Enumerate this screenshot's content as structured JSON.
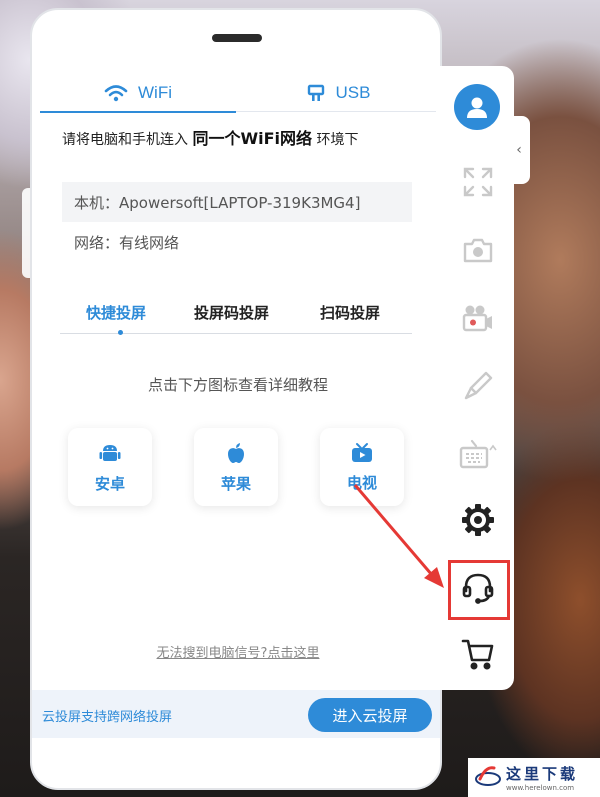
{
  "connection_tabs": {
    "wifi": "WiFi",
    "usb": "USB"
  },
  "instruction": {
    "prefix": "请将电脑和手机连入 ",
    "emphasis": "同一个WiFi网络",
    "suffix": " 环境下"
  },
  "device": {
    "label": "本机：Apowersoft[LAPTOP-319K3MG4]"
  },
  "network": {
    "label": "网络：有线网络"
  },
  "modes": [
    "快捷投屏",
    "投屏码投屏",
    "扫码投屏"
  ],
  "tutorial_hint": "点击下方图标查看详细教程",
  "os_cards": [
    "安卓",
    "苹果",
    "电视"
  ],
  "help_link": "无法搜到电脑信号?点击这里",
  "cloud": {
    "description": "云投屏支持跨网络投屏",
    "button": "进入云投屏"
  },
  "toolbar_icons": [
    "user-icon",
    "fullscreen-icon",
    "screenshot-camera-icon",
    "record-video-icon",
    "brush-icon",
    "keyboard-icon",
    "settings-gear-icon",
    "customer-support-headset-icon",
    "cart-icon"
  ],
  "watermark": {
    "cn": "这里下载",
    "en": "www.herelown.com"
  },
  "colors": {
    "accent": "#2e8bd8",
    "highlight": "#e53935"
  }
}
